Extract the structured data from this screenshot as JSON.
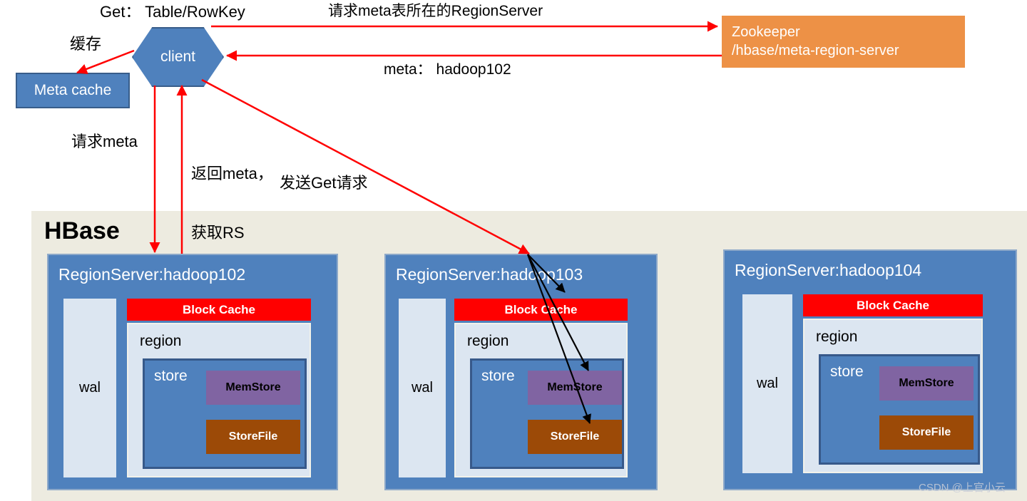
{
  "diagram": {
    "title_text": "HBase",
    "watermark": "CSDN @上官小云"
  },
  "top": {
    "get_label": "Get： Table/RowKey",
    "cache_label": "缓存",
    "client_label": "client",
    "meta_cache_label": "Meta cache",
    "request_meta_rs_label": "请求meta表所在的RegionServer",
    "meta_hadoop_label": "meta： hadoop102",
    "zookeeper_line1": "Zookeeper",
    "zookeeper_line2": "/hbase/meta-region-server"
  },
  "mid_labels": {
    "request_meta": "请求meta",
    "return_meta_line1": "返回meta，",
    "return_meta_line2": "获取RS",
    "send_get": "发送Get请求"
  },
  "region_servers": [
    {
      "title": "RegionServer:hadoop102",
      "wal": "wal",
      "block_cache": "Block Cache",
      "region": "region",
      "store": "store",
      "memstore": "MemStore",
      "storefile": "StoreFile"
    },
    {
      "title": "RegionServer:hadoop103",
      "wal": "wal",
      "block_cache": "Block Cache",
      "region": "region",
      "store": "store",
      "memstore": "MemStore",
      "storefile": "StoreFile"
    },
    {
      "title": "RegionServer:hadoop104",
      "wal": "wal",
      "block_cache": "Block Cache",
      "region": "region",
      "store": "store",
      "memstore": "MemStore",
      "storefile": "StoreFile"
    }
  ],
  "colors": {
    "blue": "#4F81BD",
    "blue_border": "#385D8A",
    "orange": "#ED9146",
    "red": "#FF0000",
    "purple": "#8064A2",
    "brown": "#9C4A07",
    "light_blue": "#DCE6F1",
    "panel_bg": "#EDEBE0",
    "arrow_red": "#FF0000",
    "arrow_black": "#000000"
  }
}
